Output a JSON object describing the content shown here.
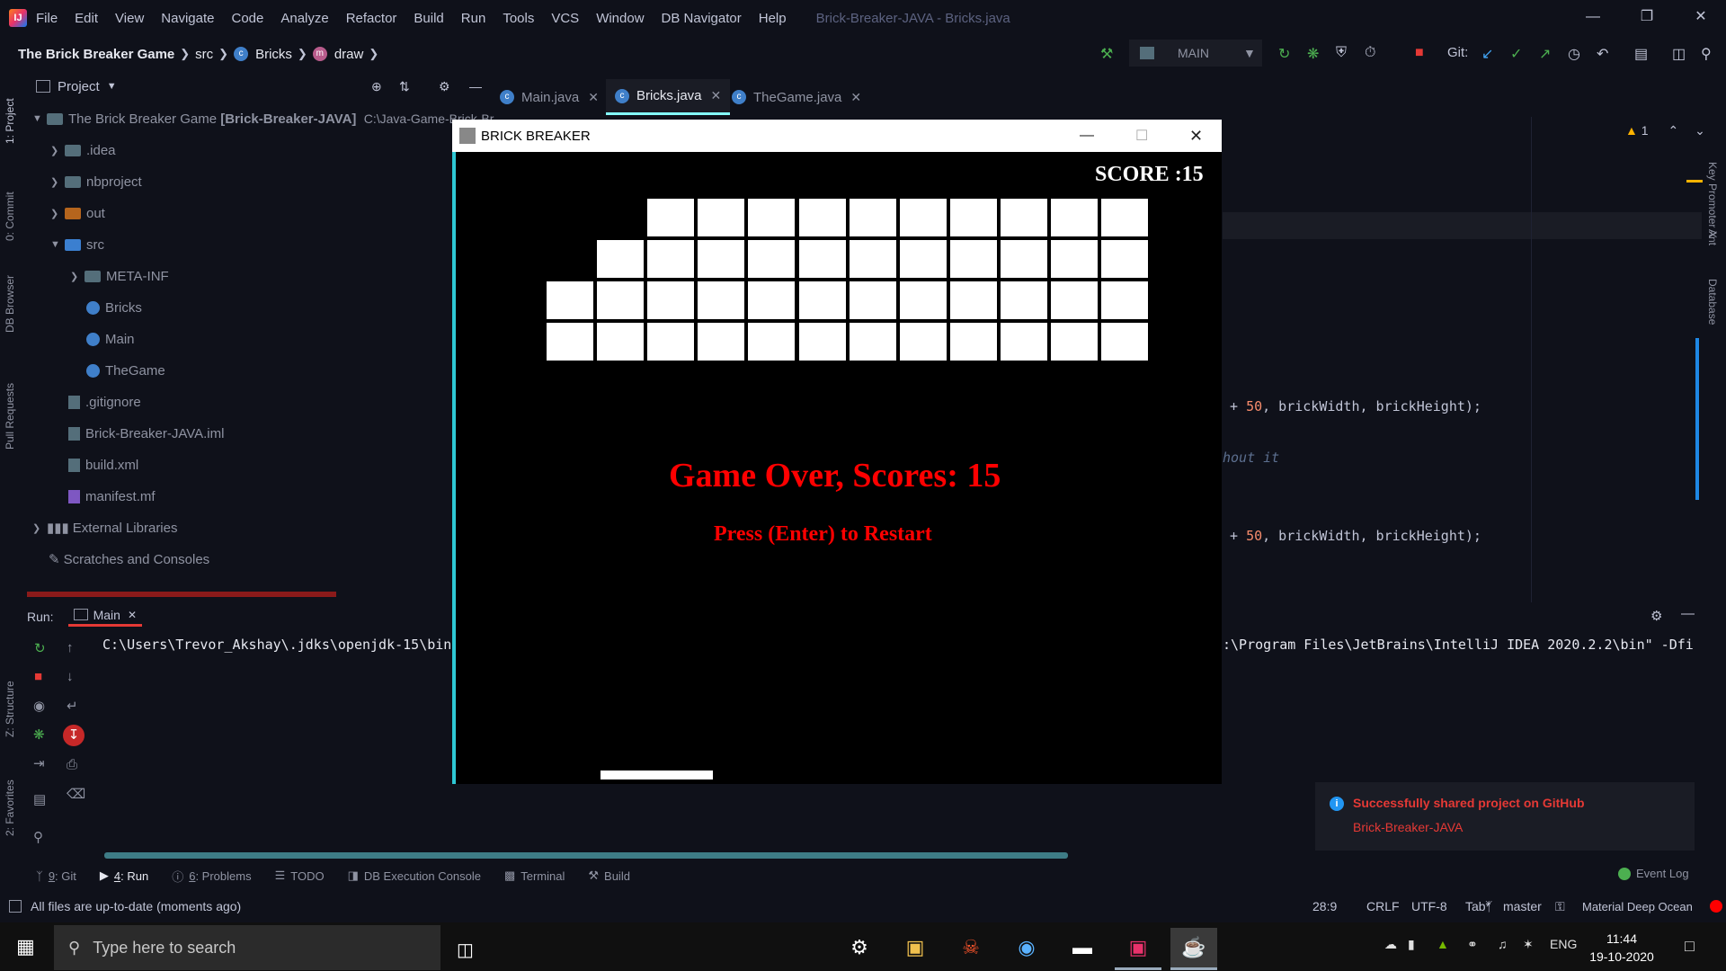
{
  "menubar": {
    "items": [
      "File",
      "Edit",
      "View",
      "Navigate",
      "Code",
      "Analyze",
      "Refactor",
      "Build",
      "Run",
      "Tools",
      "VCS",
      "Window",
      "DB Navigator",
      "Help"
    ],
    "window_title": "Brick-Breaker-JAVA - Bricks.java"
  },
  "navbar": {
    "project": "The Brick Breaker Game",
    "src": "src",
    "class": "Bricks",
    "method": "draw",
    "run_config": "MAIN",
    "git_label": "Git:"
  },
  "left_tabs": [
    "1: Project",
    "0: Commit",
    "DB Browser",
    "Pull Requests",
    "Z: Structure",
    "2: Favorites"
  ],
  "right_tabs": [
    "Key Promoter X",
    "Ant",
    "Database"
  ],
  "project_panel": {
    "title": "Project",
    "root": "The Brick Breaker Game",
    "root_module": "[Brick-Breaker-JAVA]",
    "root_path": "C:\\Java-Game-Brick-Br",
    "items": [
      {
        "label": ".idea",
        "type": "folder"
      },
      {
        "label": "nbproject",
        "type": "folder"
      },
      {
        "label": "out",
        "type": "folder-orange"
      },
      {
        "label": "src",
        "type": "folder-blue"
      },
      {
        "label": "META-INF",
        "type": "folder"
      },
      {
        "label": "Bricks",
        "type": "class"
      },
      {
        "label": "Main",
        "type": "class"
      },
      {
        "label": "TheGame",
        "type": "class"
      },
      {
        "label": ".gitignore",
        "type": "file"
      },
      {
        "label": "Brick-Breaker-JAVA.iml",
        "type": "file"
      },
      {
        "label": "build.xml",
        "type": "file"
      },
      {
        "label": "manifest.mf",
        "type": "file"
      },
      {
        "label": "External Libraries",
        "type": "lib"
      },
      {
        "label": "Scratches and Consoles",
        "type": "scratch"
      }
    ]
  },
  "editor": {
    "tabs": [
      "Main.java",
      "Bricks.java",
      "TheGame.java"
    ],
    "active_tab": "Bricks.java",
    "warning_count": "1",
    "code_lines": [
      {
        "pre": "+ ",
        "num": "50",
        "post": ", brickWidth, brickHeight);"
      },
      {
        "comment": "hout it"
      },
      {
        "pre": "+ ",
        "num": "50",
        "post": ", brickWidth, brickHeight);"
      }
    ]
  },
  "run_panel": {
    "label": "Run:",
    "tab": "Main",
    "cmd_left": "C:\\Users\\Trevor_Akshay\\.jdks\\openjdk-15\\bin",
    "cmd_right": ":\\Program Files\\JetBrains\\IntelliJ IDEA 2020.2.2\\bin\" -Dfi"
  },
  "bottom_tools": [
    {
      "num": "9",
      "label": ": Git"
    },
    {
      "num": "4",
      "label": ": Run"
    },
    {
      "num": "6",
      "label": ": Problems"
    },
    {
      "num": "",
      "label": "TODO"
    },
    {
      "num": "",
      "label": "DB Execution Console"
    },
    {
      "num": "",
      "label": "Terminal"
    },
    {
      "num": "",
      "label": "Build"
    }
  ],
  "event_log": "Event Log",
  "notification": {
    "title": "Successfully shared project on GitHub",
    "link": "Brick-Breaker-JAVA"
  },
  "status": {
    "message": "All files are up-to-date (moments ago)",
    "position": "28:9",
    "line_sep": "CRLF",
    "encoding": "UTF-8",
    "indent": "Tab*",
    "branch": "master",
    "theme": "Material Deep Ocean"
  },
  "game": {
    "title": "BRICK BREAKER",
    "score": "SCORE :15",
    "game_over": "Game Over, Scores: 15",
    "restart": "Press (Enter) to Restart",
    "brick_rows": [
      [
        0,
        0,
        1,
        1,
        1,
        1,
        1,
        1,
        1,
        1,
        1,
        1
      ],
      [
        0,
        1,
        1,
        1,
        1,
        1,
        1,
        1,
        1,
        1,
        1,
        1
      ],
      [
        1,
        1,
        1,
        1,
        1,
        1,
        1,
        1,
        1,
        1,
        1,
        1
      ],
      [
        1,
        1,
        1,
        1,
        1,
        1,
        1,
        1,
        1,
        1,
        1,
        1
      ]
    ]
  },
  "taskbar": {
    "search_placeholder": "Type here to search",
    "lang": "ENG",
    "time": "11:44",
    "date": "19-10-2020"
  },
  "colors": {
    "background": "#0f111a",
    "accent": "#84ffff",
    "error": "#e53935",
    "game_text": "#ff0000"
  }
}
